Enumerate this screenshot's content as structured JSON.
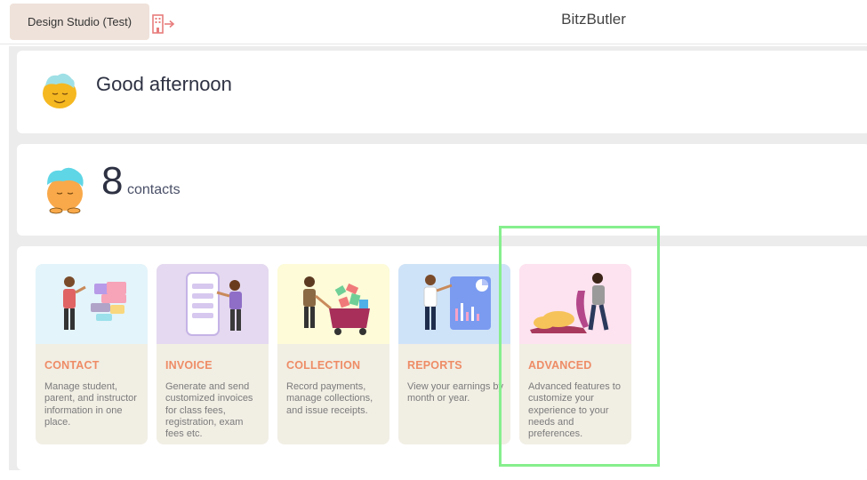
{
  "header": {
    "org_button": "Design Studio (Test)",
    "switch_icon": "building-exit-icon",
    "app_title": "BitzButler"
  },
  "greeting": {
    "text": "Good afternoon",
    "avatar": "mascot-avatar-icon"
  },
  "contacts": {
    "count": "8",
    "label": "contacts",
    "avatar": "mascot-avatar-icon"
  },
  "modules": [
    {
      "title": "CONTACT",
      "description": "Manage student, parent, and instructor information in one place.",
      "color": "#e3f4fb"
    },
    {
      "title": "INVOICE",
      "description": "Generate and send customized invoices for class fees, registration, exam fees etc.",
      "color": "#e4d9f0"
    },
    {
      "title": "COLLECTION",
      "description": "Record payments, manage collections, and issue receipts.",
      "color": "#fdfbd8"
    },
    {
      "title": "REPORTS",
      "description": "View your earnings by month or year.",
      "color": "#cfe3f8"
    },
    {
      "title": "ADVANCED",
      "description": "Advanced features to customize your experience to your needs and preferences.",
      "color": "#fde2ef"
    }
  ],
  "colors": {
    "accent": "#ee8c66",
    "org_button_bg": "#efe2da",
    "highlight": "#86ef8d"
  }
}
